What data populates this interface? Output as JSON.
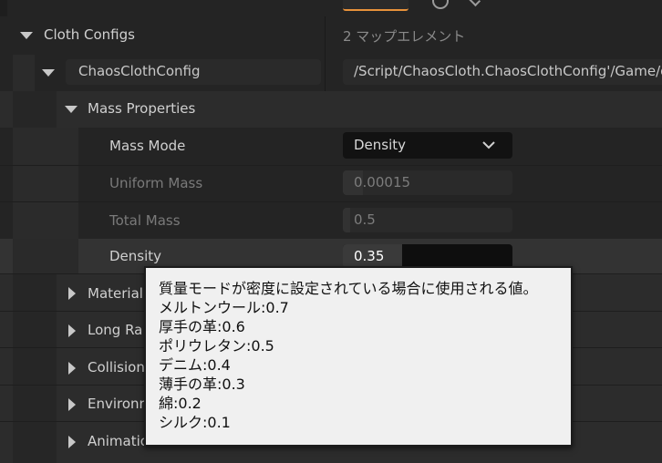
{
  "cloth_configs": {
    "label": "Cloth Configs",
    "value": "2 マップエレメント"
  },
  "chaos_cloth_config": {
    "key": "ChaosClothConfig",
    "path": "/Script/ChaosCloth.ChaosClothConfig'/Game/o"
  },
  "mass_properties": {
    "label": "Mass Properties",
    "mass_mode": {
      "label": "Mass Mode",
      "value": "Density"
    },
    "uniform_mass": {
      "label": "Uniform Mass",
      "value": "0.00015"
    },
    "total_mass": {
      "label": "Total Mass",
      "value": "0.5"
    },
    "density": {
      "label": "Density",
      "value": "0.35",
      "fill_fraction": 0.35
    }
  },
  "collapsed_sections": [
    {
      "label": "Material"
    },
    {
      "label": "Long Ra"
    },
    {
      "label": "Collision"
    },
    {
      "label": "Environr"
    },
    {
      "label": "Animatio"
    }
  ],
  "tooltip": {
    "lines": [
      "質量モードが密度に設定されている場合に使用される値。",
      "メルトンウール:0.7",
      "厚手の革:0.6",
      "ポリウレタン:0.5",
      "デニム:0.4",
      "薄手の革:0.3",
      "綿:0.2",
      "シルク:0.1"
    ]
  },
  "colors": {
    "accent_orange": "#e8923a",
    "panel_bg": "#242424",
    "field_bg": "#1a1a1a",
    "tooltip_bg": "#f0f0f0"
  }
}
